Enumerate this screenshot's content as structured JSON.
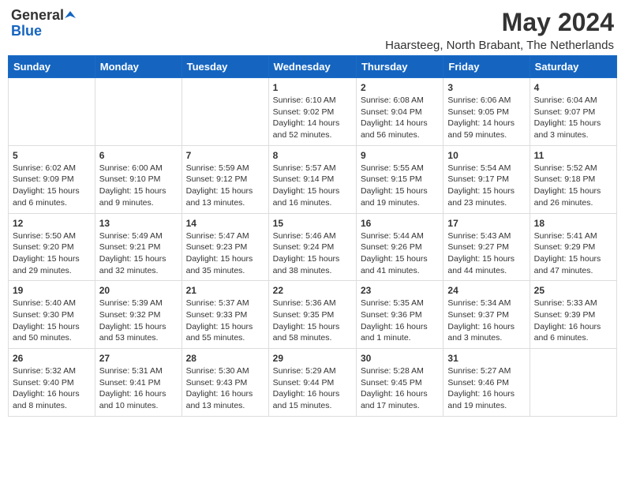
{
  "header": {
    "logo_general": "General",
    "logo_blue": "Blue",
    "month_year": "May 2024",
    "location": "Haarsteeg, North Brabant, The Netherlands"
  },
  "weekdays": [
    "Sunday",
    "Monday",
    "Tuesday",
    "Wednesday",
    "Thursday",
    "Friday",
    "Saturday"
  ],
  "weeks": [
    [
      {
        "day": "",
        "info": ""
      },
      {
        "day": "",
        "info": ""
      },
      {
        "day": "",
        "info": ""
      },
      {
        "day": "1",
        "info": "Sunrise: 6:10 AM\nSunset: 9:02 PM\nDaylight: 14 hours and 52 minutes."
      },
      {
        "day": "2",
        "info": "Sunrise: 6:08 AM\nSunset: 9:04 PM\nDaylight: 14 hours and 56 minutes."
      },
      {
        "day": "3",
        "info": "Sunrise: 6:06 AM\nSunset: 9:05 PM\nDaylight: 14 hours and 59 minutes."
      },
      {
        "day": "4",
        "info": "Sunrise: 6:04 AM\nSunset: 9:07 PM\nDaylight: 15 hours and 3 minutes."
      }
    ],
    [
      {
        "day": "5",
        "info": "Sunrise: 6:02 AM\nSunset: 9:09 PM\nDaylight: 15 hours and 6 minutes."
      },
      {
        "day": "6",
        "info": "Sunrise: 6:00 AM\nSunset: 9:10 PM\nDaylight: 15 hours and 9 minutes."
      },
      {
        "day": "7",
        "info": "Sunrise: 5:59 AM\nSunset: 9:12 PM\nDaylight: 15 hours and 13 minutes."
      },
      {
        "day": "8",
        "info": "Sunrise: 5:57 AM\nSunset: 9:14 PM\nDaylight: 15 hours and 16 minutes."
      },
      {
        "day": "9",
        "info": "Sunrise: 5:55 AM\nSunset: 9:15 PM\nDaylight: 15 hours and 19 minutes."
      },
      {
        "day": "10",
        "info": "Sunrise: 5:54 AM\nSunset: 9:17 PM\nDaylight: 15 hours and 23 minutes."
      },
      {
        "day": "11",
        "info": "Sunrise: 5:52 AM\nSunset: 9:18 PM\nDaylight: 15 hours and 26 minutes."
      }
    ],
    [
      {
        "day": "12",
        "info": "Sunrise: 5:50 AM\nSunset: 9:20 PM\nDaylight: 15 hours and 29 minutes."
      },
      {
        "day": "13",
        "info": "Sunrise: 5:49 AM\nSunset: 9:21 PM\nDaylight: 15 hours and 32 minutes."
      },
      {
        "day": "14",
        "info": "Sunrise: 5:47 AM\nSunset: 9:23 PM\nDaylight: 15 hours and 35 minutes."
      },
      {
        "day": "15",
        "info": "Sunrise: 5:46 AM\nSunset: 9:24 PM\nDaylight: 15 hours and 38 minutes."
      },
      {
        "day": "16",
        "info": "Sunrise: 5:44 AM\nSunset: 9:26 PM\nDaylight: 15 hours and 41 minutes."
      },
      {
        "day": "17",
        "info": "Sunrise: 5:43 AM\nSunset: 9:27 PM\nDaylight: 15 hours and 44 minutes."
      },
      {
        "day": "18",
        "info": "Sunrise: 5:41 AM\nSunset: 9:29 PM\nDaylight: 15 hours and 47 minutes."
      }
    ],
    [
      {
        "day": "19",
        "info": "Sunrise: 5:40 AM\nSunset: 9:30 PM\nDaylight: 15 hours and 50 minutes."
      },
      {
        "day": "20",
        "info": "Sunrise: 5:39 AM\nSunset: 9:32 PM\nDaylight: 15 hours and 53 minutes."
      },
      {
        "day": "21",
        "info": "Sunrise: 5:37 AM\nSunset: 9:33 PM\nDaylight: 15 hours and 55 minutes."
      },
      {
        "day": "22",
        "info": "Sunrise: 5:36 AM\nSunset: 9:35 PM\nDaylight: 15 hours and 58 minutes."
      },
      {
        "day": "23",
        "info": "Sunrise: 5:35 AM\nSunset: 9:36 PM\nDaylight: 16 hours and 1 minute."
      },
      {
        "day": "24",
        "info": "Sunrise: 5:34 AM\nSunset: 9:37 PM\nDaylight: 16 hours and 3 minutes."
      },
      {
        "day": "25",
        "info": "Sunrise: 5:33 AM\nSunset: 9:39 PM\nDaylight: 16 hours and 6 minutes."
      }
    ],
    [
      {
        "day": "26",
        "info": "Sunrise: 5:32 AM\nSunset: 9:40 PM\nDaylight: 16 hours and 8 minutes."
      },
      {
        "day": "27",
        "info": "Sunrise: 5:31 AM\nSunset: 9:41 PM\nDaylight: 16 hours and 10 minutes."
      },
      {
        "day": "28",
        "info": "Sunrise: 5:30 AM\nSunset: 9:43 PM\nDaylight: 16 hours and 13 minutes."
      },
      {
        "day": "29",
        "info": "Sunrise: 5:29 AM\nSunset: 9:44 PM\nDaylight: 16 hours and 15 minutes."
      },
      {
        "day": "30",
        "info": "Sunrise: 5:28 AM\nSunset: 9:45 PM\nDaylight: 16 hours and 17 minutes."
      },
      {
        "day": "31",
        "info": "Sunrise: 5:27 AM\nSunset: 9:46 PM\nDaylight: 16 hours and 19 minutes."
      },
      {
        "day": "",
        "info": ""
      }
    ]
  ]
}
